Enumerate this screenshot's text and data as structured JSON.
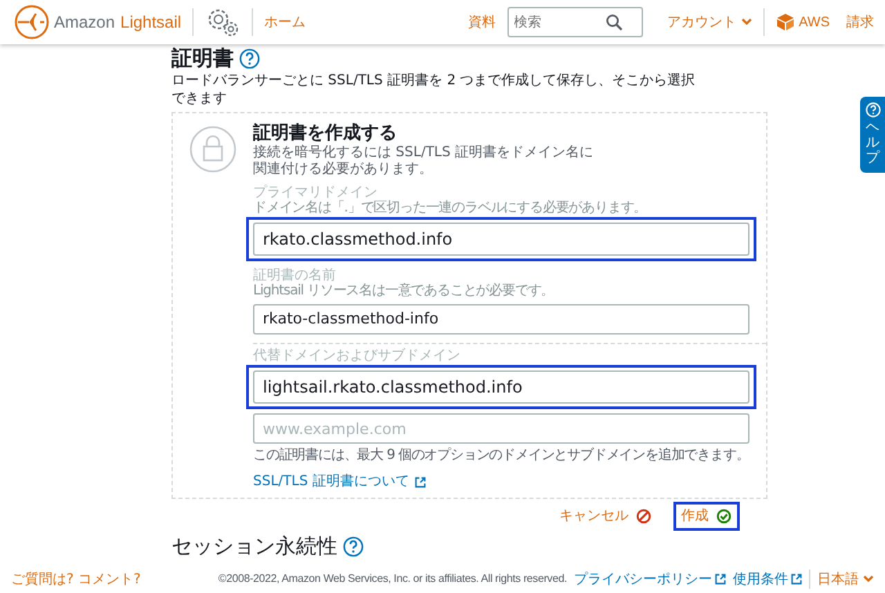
{
  "header": {
    "brand_prefix": "Amazon",
    "brand_name": "Lightsail",
    "nav_link": "ホーム",
    "docs_link": "資料",
    "search": {
      "placeholder": "検索"
    },
    "account_menu": "アカウント",
    "aws_link": "AWS",
    "billing_link": "請求"
  },
  "section": {
    "title": "証明書",
    "description": "ロードバランサーごとに SSL/TLS 証明書を 2 つまで作成して保存し、そこから選択できます"
  },
  "card": {
    "title": "証明書を作成する",
    "description": "接続を暗号化するには SSL/TLS 証明書をドメイン名に関連付ける必要があります。",
    "fields": [
      {
        "label": "プライマリドメイン",
        "hint": "ドメイン名は「.」で区切った一連のラベルにする必要があります。",
        "value": "rkato.classmethod.info",
        "highlighted": true
      },
      {
        "label": "証明書の名前",
        "hint": "Lightsail リソース名は一意であることが必要です。",
        "value": "rkato-classmethod-info",
        "highlighted": false
      }
    ],
    "alternates": {
      "label": "代替ドメインおよびサブドメイン",
      "entries": [
        {
          "value": "lightsail.rkato.classmethod.info",
          "highlighted": true
        },
        {
          "placeholder": "www.example.com",
          "highlighted": false
        }
      ],
      "note": "この証明書には、最大 9 個のオプションのドメインとサブドメインを追加できます。"
    },
    "link": "SSL/TLS 証明書について"
  },
  "actions": [
    {
      "kind": "cancel",
      "label": "キャンセル",
      "highlighted": false
    },
    {
      "kind": "create",
      "label": "作成",
      "highlighted": true
    }
  ],
  "next_section": "セッション永続性",
  "footer": {
    "feedback": "ご質問は? コメント?",
    "copyright": "©2008-2022, Amazon Web Services, Inc. or its affiliates. All rights reserved.",
    "links": [
      "プライバシーポリシー",
      "使用条件"
    ],
    "language": "日本語"
  },
  "help_tab": "ヘルプ"
}
